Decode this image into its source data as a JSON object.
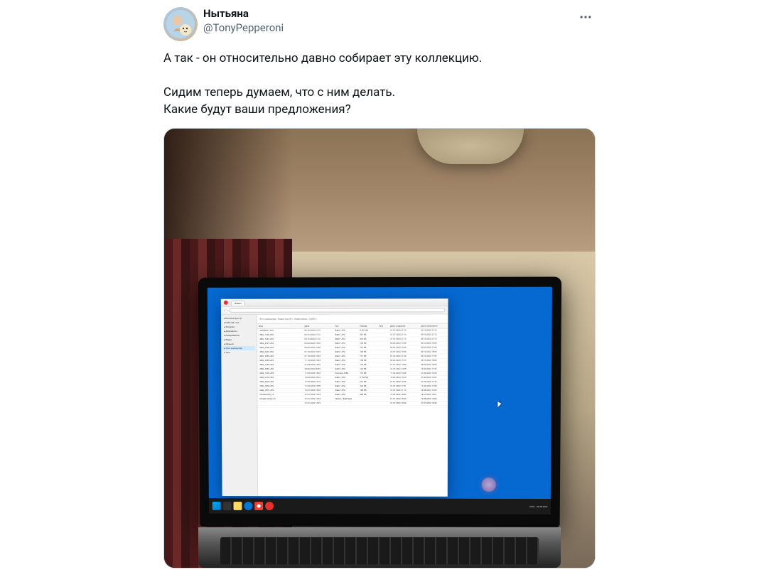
{
  "tweet": {
    "display_name": "Нытьяна",
    "handle": "@TonyPepperoni",
    "body": "А так - он относительно давно собирает эту коллекцию.\n\nСидим теперь думаем, что с ним делать.\nКакие будут ваши предложения?"
  },
  "browser": {
    "title": "Яндекс"
  },
  "explorer": {
    "path": "Этот компьютер › Новый том (E:) › Новая папка › 123987 ›",
    "search_placeholder": "Поиск: 123987",
    "sidebar": [
      {
        "label": "Быстрый доступ"
      },
      {
        "label": "Рабочий стол"
      },
      {
        "label": "Загрузки"
      },
      {
        "label": "Документы"
      },
      {
        "label": "Изображения"
      },
      {
        "label": "Видео"
      },
      {
        "label": "Музыка"
      },
      {
        "label": "Этот компьютер",
        "selected": true
      },
      {
        "label": "Сеть"
      }
    ],
    "columns": [
      "Имя",
      "Дата",
      "Тип",
      "Размер",
      "Теги",
      "Дата создания",
      "Дата изменения"
    ],
    "rows": [
      {
        "name": "20200221.JPG",
        "date": "04.10.2022 21:12",
        "type": "Файл \"JPG\"",
        "size": "3 381 КБ",
        "created": "21.07.2022 21:12",
        "mod": "04.10.2022 21:12"
      },
      {
        "name": "IMG_1230.JPG",
        "date": "04.10.2022 21:12",
        "type": "Файл \"JPG\"",
        "size": "351 КБ",
        "created": "21.07.2022 21:12",
        "mod": "04.10.2022 21:12"
      },
      {
        "name": "IMG_7042.JPG",
        "date": "04.10.2022 21:12",
        "type": "Файл \"JPG\"",
        "size": "302 КБ",
        "created": "21.07.2022 21:12",
        "mod": "04.10.2022 21:12"
      },
      {
        "name": "IMG_4707.JPG",
        "date": "03.02.2022 19:30",
        "type": "Файл \"JPG\"",
        "size": "109 КБ",
        "created": "03.02.2022 19:30",
        "mod": "03.10.2022 18:04"
      },
      {
        "name": "IMG_6398.JPG",
        "date": "03.02.2022 19:30",
        "type": "Файл \"JPG\"",
        "size": "101 КБ",
        "created": "03.02.2022 19:30",
        "mod": "05.02.2022 17:09"
      },
      {
        "name": "IMG_6442.JPG",
        "date": "01.10.2022 19:44",
        "type": "Файл \"JPG\"",
        "size": "103 КБ",
        "created": "22.07.2022 19:35",
        "mod": "03.10.2022 18:04"
      },
      {
        "name": "IMG_4530.JPG",
        "date": "01.10.2022 19:44",
        "type": "Файл \"JPG\"",
        "size": "741 КБ",
        "created": "01.02.2022 21:30",
        "mod": "05.10.2022 17:09"
      },
      {
        "name": "IMG_2485.JPG",
        "date": "11.10.2022 19:44",
        "type": "Файл \"JPG\"",
        "size": "154 КБ",
        "created": "04.02.2022 19:13",
        "mod": "20.10.2022 18:00"
      },
      {
        "name": "IMG_1283.JPG",
        "date": "21.04.2022 13:03",
        "type": "Файл \"JPG\"",
        "size": "124 КБ",
        "created": "21.07.2022 13:05",
        "mod": "28.04.2022 18:03"
      },
      {
        "name": "IMG_3482.JPG",
        "date": "29.06.2022 20:02",
        "type": "Файл \"JPG\"",
        "size": "124 КБ",
        "created": "21.07.2022 13:35",
        "mod": "13.04.2022 17:47"
      },
      {
        "name": "IMG_1932.JPG",
        "date": "11.03.2022 13:02",
        "type": "Рисунок JPEG",
        "size": "116 КБ",
        "created": "11.02.2022 15:30",
        "mod": "21.04.2022 13:03"
      },
      {
        "name": "IMG_9142.JPG",
        "date": "13.04.2022 18:22",
        "type": "Файл \"JPG\"",
        "size": "2 754 КБ",
        "created": "13.02.2022 15:13",
        "mod": "21.06.2022 13:07"
      },
      {
        "name": "IMG_6642.JPG",
        "date": "11.03.2022 14:13",
        "type": "Файл \"JPG\"",
        "size": "214 КБ",
        "created": "21.07.2022 19:35",
        "mod": "21.04.2022 17:47"
      },
      {
        "name": "IMG_3953.JPG",
        "date": "11.03.2022 13:58",
        "type": "Файл \"JPG\"",
        "size": "124 КБ",
        "created": "21.07.2022 17:41",
        "mod": "11.04.2022 11:08"
      },
      {
        "name": "IMG_2831.JPG",
        "date": "19.07.2022 19:03",
        "type": "Файл \"JPG\"",
        "size": "186 КБ",
        "created": "21.07.2022 21:12",
        "mod": "19.08.2022 19:03"
      },
      {
        "name": "Screenshot_13",
        "date": "21.01.2022 13:34",
        "type": "Файл \"JPG\"",
        "size": "364 КБ",
        "created": "13.02.2022 18:03",
        "mod": "19.07.2022 10:01"
      },
      {
        "name": "Новая папка (2)",
        "date": "21.01.2022 13:34",
        "type": "Папка с файлами",
        "size": "",
        "created": "21.07.2022 18:40",
        "mod": "19.08.2022 13:00"
      },
      {
        "name": "",
        "date": "21.01.2022 13:34",
        "type": "",
        "size": "",
        "created": "21.07.2022 18:40",
        "mod": "21.07.2022 10:40"
      }
    ]
  },
  "taskbar": {
    "time": "18:45",
    "date": "09.08.2023"
  }
}
